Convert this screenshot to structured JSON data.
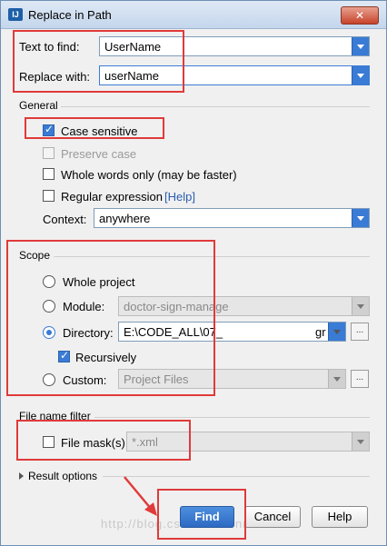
{
  "window": {
    "title": "Replace in Path",
    "icon": "intellij-icon",
    "close_label": "✕"
  },
  "search": {
    "text_to_find_label": "Text to find:",
    "text_to_find_value": "UserName",
    "replace_with_label": "Replace with:",
    "replace_with_value": "userName"
  },
  "general": {
    "section_label": "General",
    "case_sensitive": {
      "label": "Case sensitive",
      "checked": true
    },
    "preserve_case": {
      "label": "Preserve case",
      "checked": false,
      "disabled": true
    },
    "whole_words": {
      "label": "Whole words only (may be faster)",
      "checked": false
    },
    "regex": {
      "label": "Regular expression",
      "help": "[Help]",
      "checked": false
    },
    "context_label": "Context:",
    "context_value": "anywhere"
  },
  "scope": {
    "section_label": "Scope",
    "whole_project": "Whole project",
    "module_label": "Module:",
    "module_value": "doctor-sign-manage",
    "directory_label": "Directory:",
    "directory_value": "E:\\CODE_ALL\\07_",
    "directory_value_end": "gr",
    "recursively": {
      "label": "Recursively",
      "checked": true
    },
    "custom_label": "Custom:",
    "custom_value": "Project Files",
    "selected": "directory",
    "browse_label": "..."
  },
  "filter": {
    "section_label": "File name filter",
    "mask_label": "File mask(s)",
    "mask_value": "*.xml",
    "mask_checked": false
  },
  "result_options": {
    "label": "Result options"
  },
  "buttons": {
    "find": "Find",
    "cancel": "Cancel",
    "help": "Help"
  },
  "watermark": "http://blog.csdn.net/renrulei",
  "colors": {
    "accent": "#3a7bd5",
    "highlight": "#e03a3a"
  }
}
